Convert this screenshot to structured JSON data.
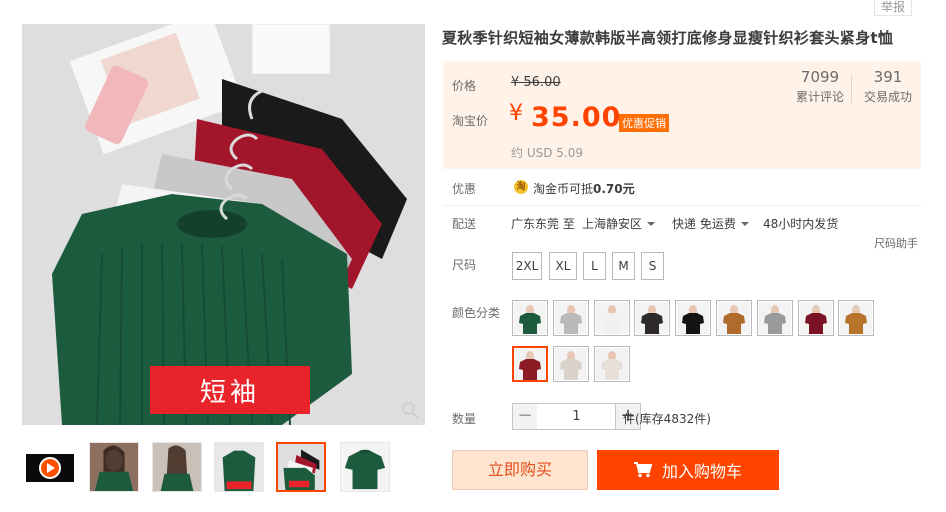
{
  "header": {
    "report_label": "举报"
  },
  "product": {
    "title": "夏秋季针织短袖女薄款韩版半高领打底修身显瘦针织衫套头紧身t恤"
  },
  "gallery": {
    "badge_text": "短袖",
    "video_label": "play-video",
    "thumbnails": [
      "thumb-1",
      "thumb-2",
      "thumb-3",
      "thumb-4",
      "thumb-5"
    ],
    "selected_thumbnail": 4
  },
  "price": {
    "label": "价格",
    "original": "¥ 56.00",
    "taobao_label": "淘宝价",
    "currency": "¥",
    "amount": "35.00",
    "promo_tag": "优惠促销",
    "usd": "约 USD 5.09"
  },
  "stats": {
    "reviews_count": "7099",
    "reviews_label": "累计评论",
    "sales_count": "391",
    "sales_label": "交易成功"
  },
  "discount": {
    "label": "优惠",
    "coin_glyph": "淘",
    "text_prefix": "淘金币可抵",
    "amount": "0.70元"
  },
  "shipping": {
    "label": "配送",
    "from": "广东东莞 至",
    "to": "上海静安区",
    "method": "快递 免运费",
    "dispatch": "48小时内发货"
  },
  "size": {
    "label": "尺码",
    "helper": "尺码助手",
    "options": [
      "2XL",
      "XL",
      "L",
      "M",
      "S"
    ]
  },
  "color": {
    "label": "颜色分类",
    "selected_index": 9,
    "swatches": [
      "#1e5a3e",
      "#b9b9b9",
      "#f0f0f0",
      "#2f2a2a",
      "#141414",
      "#b06a2c",
      "#9a9a9a",
      "#7a1424",
      "#b8742a",
      "#8b1c24",
      "#d9d2c9",
      "#e6e0d8"
    ]
  },
  "quantity": {
    "label": "数量",
    "minus": "−",
    "value": "1",
    "plus": "+",
    "stock": "件(库存4832件)"
  },
  "actions": {
    "buy_now": "立即购买",
    "add_to_cart": "加入购物车"
  },
  "colors": {
    "accent": "#ff4400",
    "price_bg": "#fff2e8",
    "promo": "#ff6f06"
  }
}
